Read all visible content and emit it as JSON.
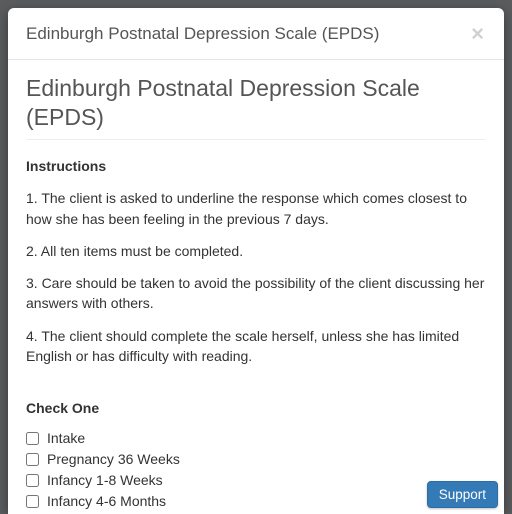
{
  "modal": {
    "title": "Edinburgh Postnatal Depression Scale (EPDS)",
    "close_glyph": "×"
  },
  "page": {
    "title": "Edinburgh Postnatal Depression Scale (EPDS)"
  },
  "instructions": {
    "heading": "Instructions",
    "items": [
      "1. The client is asked to underline the response which comes closest to how she has been feeling in the previous 7 days.",
      "2. All ten items must be completed.",
      "3. Care should be taken to avoid the possibility of the client discussing her answers with others.",
      "4. The client should complete the scale herself, unless she has limited English or has difficulty with reading."
    ]
  },
  "check_one": {
    "heading": "Check One",
    "options": [
      "Intake",
      "Pregnancy 36 Weeks",
      "Infancy 1-8 Weeks",
      "Infancy 4-6 Months"
    ]
  },
  "support": {
    "label": "Support"
  }
}
